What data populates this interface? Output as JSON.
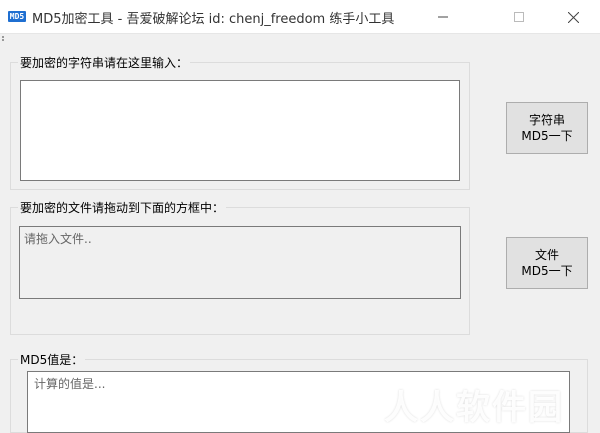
{
  "window": {
    "title": "MD5加密工具 - 吾爱破解论坛 id: chenj_freedom 练手小工具",
    "icon_text": "MD5"
  },
  "string_section": {
    "label": "要加密的字符串请在这里输入：",
    "value": "",
    "button_line1": "字符串",
    "button_line2": "MD5一下"
  },
  "file_section": {
    "label": "要加密的文件请拖动到下面的方框中：",
    "placeholder": "请拖入文件..",
    "button_line1": "文件",
    "button_line2": "MD5一下"
  },
  "result_section": {
    "label": "MD5值是：",
    "placeholder": "计算的值是..."
  },
  "watermark": "人人软件园",
  "colors": {
    "background": "#f0f0f0",
    "titlebar": "#ffffff",
    "accent": "#1f6fd1",
    "button": "#e1e1e1"
  }
}
